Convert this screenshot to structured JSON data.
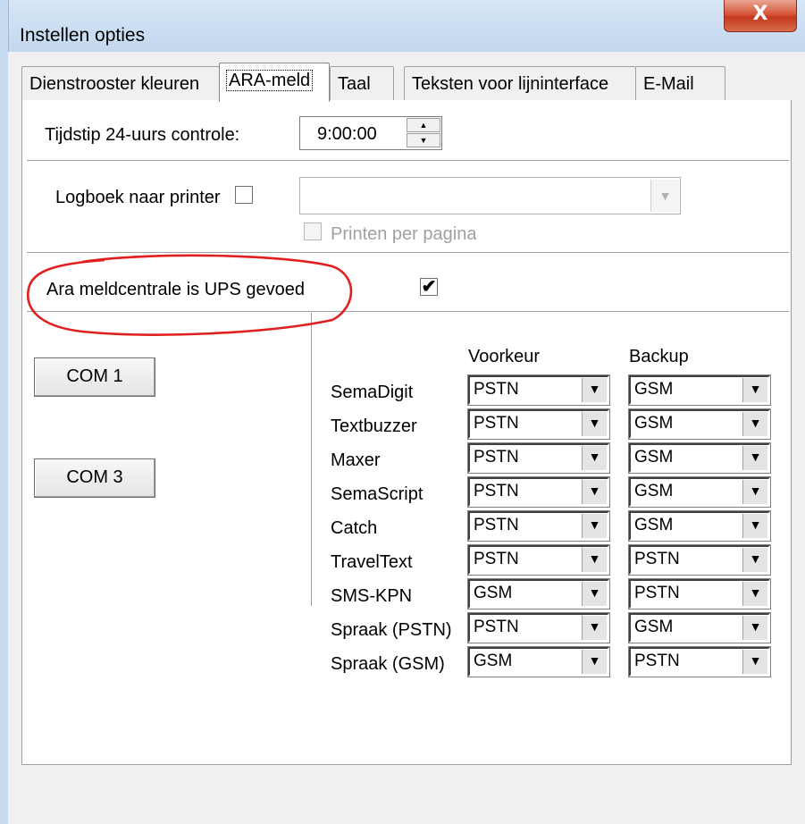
{
  "window": {
    "title": "Instellen opties",
    "close_symbol": "X"
  },
  "tabs": [
    {
      "label": "Dienstrooster kleuren"
    },
    {
      "label": "ARA-meld"
    },
    {
      "label": "Taal"
    },
    {
      "label": "Teksten voor lijninterface"
    },
    {
      "label": "E-Mail"
    }
  ],
  "active_tab": "ARA-meld",
  "check24": {
    "label": "Tijdstip 24-uurs controle:",
    "value": "9:00:00"
  },
  "logbook": {
    "label": "Logboek naar printer",
    "checked": false,
    "printer_value": "",
    "print_per_page_label": "Printen per pagina",
    "print_per_page_checked": false
  },
  "ups": {
    "label": "Ara meldcentrale is UPS gevoed",
    "checked": true
  },
  "annotation": {
    "color": "#e02020"
  },
  "com_buttons": [
    "COM 1",
    "COM 3"
  ],
  "grid": {
    "header_pref": "Voorkeur",
    "header_backup": "Backup",
    "rows": [
      {
        "name": "SemaDigit",
        "pref": "PSTN",
        "backup": "GSM"
      },
      {
        "name": "Textbuzzer",
        "pref": "PSTN",
        "backup": "GSM"
      },
      {
        "name": "Maxer",
        "pref": "PSTN",
        "backup": "GSM"
      },
      {
        "name": "SemaScript",
        "pref": "PSTN",
        "backup": "GSM"
      },
      {
        "name": "Catch",
        "pref": "PSTN",
        "backup": "GSM"
      },
      {
        "name": "TravelText",
        "pref": "PSTN",
        "backup": "PSTN"
      },
      {
        "name": "SMS-KPN",
        "pref": "GSM",
        "backup": "PSTN"
      },
      {
        "name": "Spraak (PSTN)",
        "pref": "PSTN",
        "backup": "GSM"
      },
      {
        "name": "Spraak (GSM)",
        "pref": "GSM",
        "backup": "PSTN"
      }
    ]
  },
  "icons": {
    "spin_up": "▲",
    "spin_down": "▼",
    "dropdown": "▼",
    "check": "✔"
  }
}
